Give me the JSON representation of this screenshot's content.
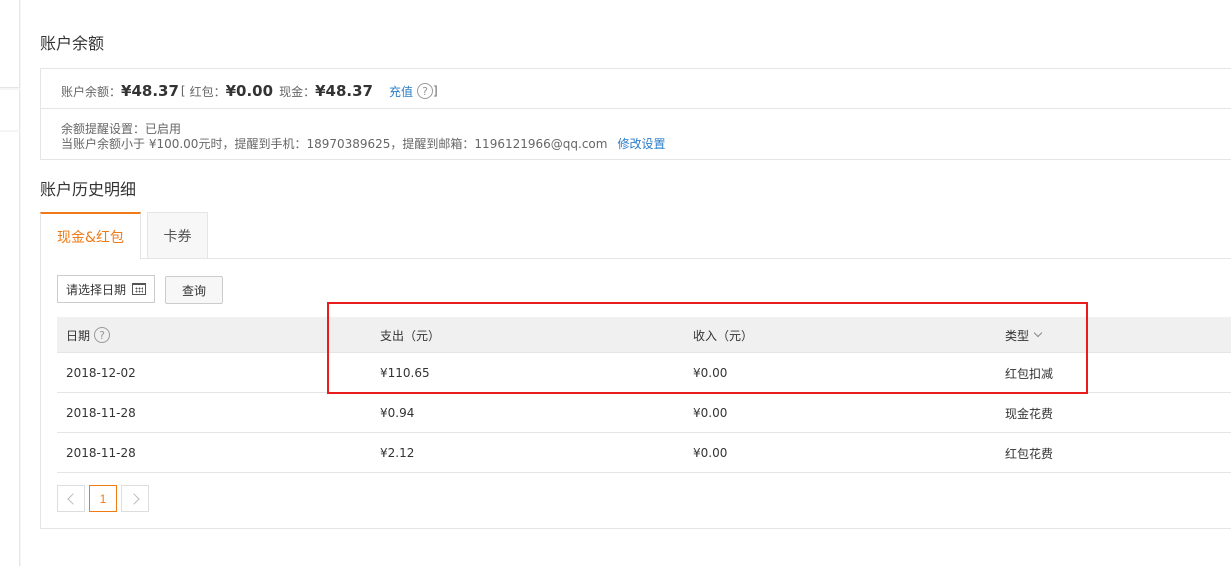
{
  "balance_section": {
    "title": "账户余额",
    "balance_label": "账户余额：",
    "balance_value": "¥48.37",
    "bracket_open": "[",
    "redpacket_label": "红包：",
    "redpacket_value": "¥0.00",
    "cash_label": "现金：",
    "cash_value": "¥48.37",
    "recharge_link": "充值",
    "help_icon_glyph": "?",
    "bracket_close": "]",
    "remind_line1": "余额提醒设置：已启用",
    "remind_line2": "当账户余额小于 ¥100.00元时，提醒到手机：18970389625，提醒到邮箱：1196121966@qq.com",
    "modify_link": "修改设置"
  },
  "history_section": {
    "title": "账户历史明细",
    "tabs": [
      {
        "label": "现金&红包",
        "active": true
      },
      {
        "label": "卡券",
        "active": false
      }
    ],
    "date_picker_label": "请选择日期",
    "query_button": "查询",
    "columns": [
      {
        "label": "日期"
      },
      {
        "label": "支出（元）"
      },
      {
        "label": "收入（元）"
      },
      {
        "label": "类型"
      }
    ],
    "rows": [
      {
        "date": "2018-12-02",
        "expense": "¥110.65",
        "income": "¥0.00",
        "type": "红包扣减"
      },
      {
        "date": "2018-11-28",
        "expense": "¥0.94",
        "income": "¥0.00",
        "type": "现金花费"
      },
      {
        "date": "2018-11-28",
        "expense": "¥2.12",
        "income": "¥0.00",
        "type": "红包花费"
      }
    ],
    "pagination": {
      "current_page": "1"
    }
  },
  "colors": {
    "accent": "#f07a16",
    "link": "#2a7cc7",
    "highlight": "#e81c1c"
  }
}
